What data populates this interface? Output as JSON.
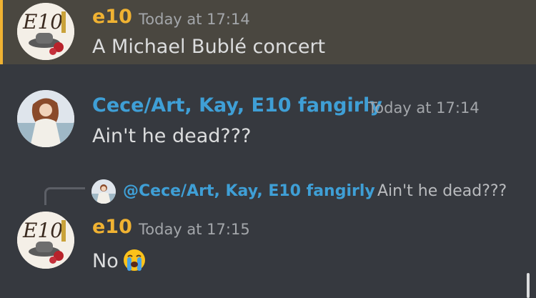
{
  "colors": {
    "background": "#36393f",
    "highlight_bg": "#4a4740",
    "highlight_bar": "#f0b232",
    "e10_name": "#f0b232",
    "cece_name": "#3f9fd6"
  },
  "messages": [
    {
      "username": "e10",
      "timestamp": "Today at 17:14",
      "content": "A Michael Bublé concert",
      "avatar": "e10-avatar"
    },
    {
      "username": "Cece/Art, Kay, E10 fangirly",
      "timestamp": "Today at 17:14",
      "content": "Ain't he dead???",
      "avatar": "cece-avatar"
    },
    {
      "reply": {
        "mention": "@Cece/Art, Kay, E10 fangirly",
        "text": "Ain't he dead???"
      },
      "username": "e10",
      "timestamp": "Today at 17:15",
      "content": "No",
      "emoji": "loudly-crying-face-icon",
      "avatar": "e10-avatar"
    }
  ]
}
